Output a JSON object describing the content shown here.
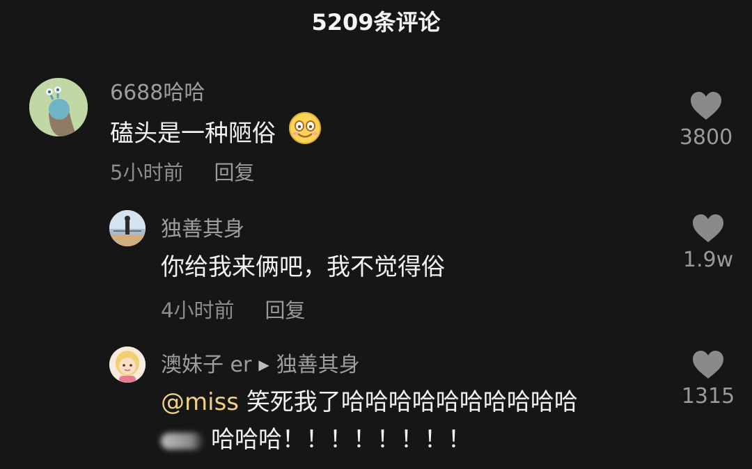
{
  "header": {
    "title": "5209条评论"
  },
  "comments": [
    {
      "author": "6688哈哈",
      "text": "磕头是一种陋俗",
      "time": "5小时前",
      "reply_label": "回复",
      "likes": "3800",
      "emoji": "smiling-face-icon"
    },
    {
      "author": "独善其身",
      "text": "你给我来俩吧，我不觉得俗",
      "time": "4小时前",
      "reply_label": "回复",
      "likes": "1.9w"
    },
    {
      "author": "澳妹子 er",
      "reply_to": "独善其身",
      "mention": "@miss",
      "text_line1": "笑死我了哈哈哈哈哈哈哈哈哈哈",
      "text_line2": "哈哈哈！！！！！！！！",
      "likes": "1315"
    }
  ],
  "colors": {
    "background": "#161616",
    "mention": "#f0cf86",
    "secondary_text": "#9e9e9e"
  }
}
